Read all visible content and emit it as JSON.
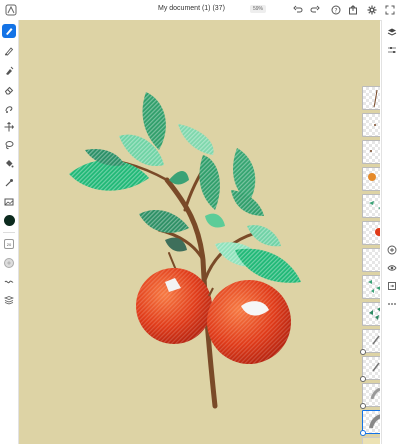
{
  "document": {
    "title": "My document (1) (37)",
    "zoom": "59%"
  },
  "toolbar": {
    "icons": [
      "undo-icon",
      "redo-icon",
      "help-icon",
      "share-icon",
      "settings-icon",
      "fullscreen-icon"
    ]
  },
  "tools": {
    "items": [
      "pixel-brush",
      "vector-brush",
      "fill-brush",
      "eraser",
      "smudge",
      "transform",
      "lasso-selection",
      "paint-bucket",
      "eyedropper",
      "image",
      "color-swatch",
      "brush-size",
      "opacity",
      "blend",
      "layer-options"
    ],
    "current_color": "#0c2a1e",
    "brush_size": "20"
  },
  "right_panel": {
    "icons": [
      "layers-icon",
      "properties-icon"
    ]
  },
  "layer_panel": {
    "actions": [
      "add-layer-icon",
      "visibility-icon",
      "merge-icon",
      "more-icon"
    ],
    "layer_count": 14,
    "selected_index": 12
  },
  "colors": {
    "accent": "#1473e6",
    "canvas": "#ddd3a5",
    "leaf": "#2f9e6a",
    "fruit": "#e2421e",
    "branch": "#7a4a28"
  }
}
